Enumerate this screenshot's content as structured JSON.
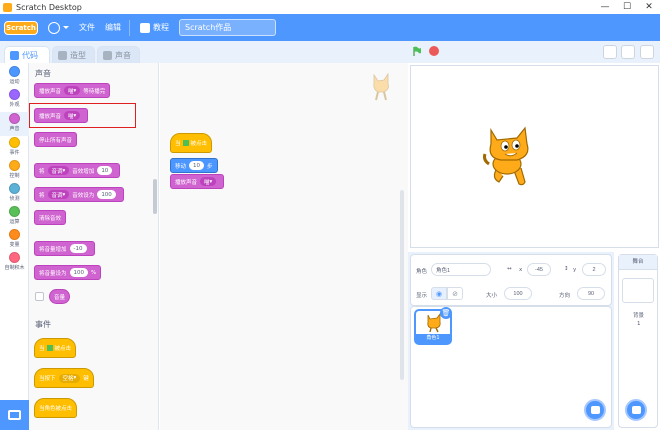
{
  "window": {
    "title": "Scratch Desktop",
    "controls": [
      "—",
      "☐",
      "✕"
    ]
  },
  "menubar": {
    "logo": "Scratch",
    "file": "文件",
    "edit": "编辑",
    "tutorials": "教程",
    "project_name": "Scratch作品"
  },
  "tabs": {
    "code": "代码",
    "costumes": "造型",
    "sounds": "声音"
  },
  "categories": [
    {
      "label": "运动",
      "color": "#4c97ff"
    },
    {
      "label": "外观",
      "color": "#9966ff"
    },
    {
      "label": "声音",
      "color": "#cf63cf"
    },
    {
      "label": "事件",
      "color": "#ffbf00"
    },
    {
      "label": "控制",
      "color": "#ffab19"
    },
    {
      "label": "侦测",
      "color": "#5cb1d6"
    },
    {
      "label": "运算",
      "color": "#59c059"
    },
    {
      "label": "变量",
      "color": "#ff8c1a"
    },
    {
      "label": "自制积木",
      "color": "#ff6680"
    }
  ],
  "palette": {
    "sound_heading": "声音",
    "play_until_done": "播放声音",
    "play_until_done_tail": "等待播完",
    "sound_name": "喵",
    "start_sound": "播放声音",
    "stop_all": "停止所有声音",
    "change_effect_by": "将",
    "effect_pitch": "音调",
    "change_tail": "音效增加",
    "change_value": "10",
    "set_effect_to": "将",
    "set_tail": "音效设为",
    "set_value": "100",
    "clear_effects": "清除音效",
    "change_volume": "将音量增加",
    "change_volume_value": "-10",
    "set_volume": "将音量设为",
    "set_volume_value": "100",
    "percent": "%",
    "volume": "音量",
    "events_heading": "事件",
    "when_flag": "当",
    "when_flag_tail": "被点击",
    "when_key": "当按下",
    "key_name": "空格",
    "key_tail": "键",
    "when_sprite_clicked": "当角色被点击"
  },
  "script": {
    "hat": "当",
    "hat_tail": "被点击",
    "move": "移动",
    "move_value": "10",
    "move_tail": "步",
    "play": "播放声音",
    "sound": "喵"
  },
  "zoom": {
    "in": "+",
    "out": "−",
    "reset": "="
  },
  "sprite_info": {
    "sprite_label": "角色",
    "sprite_name": "角色1",
    "x_label": "x",
    "x_value": "-45",
    "y_label": "y",
    "y_value": "2",
    "show_label": "显示",
    "size_label": "大小",
    "size_value": "100",
    "direction_label": "方向",
    "direction_value": "90"
  },
  "sprite_list": [
    {
      "name": "角色1"
    }
  ],
  "stage_pane": {
    "header": "舞台",
    "backdrops_label": "背景",
    "backdrops_count": "1"
  },
  "colors": {
    "accent": "#4d97ff",
    "sound": "#cf63cf",
    "event": "#ffbf00",
    "stop": "#ec5959"
  }
}
